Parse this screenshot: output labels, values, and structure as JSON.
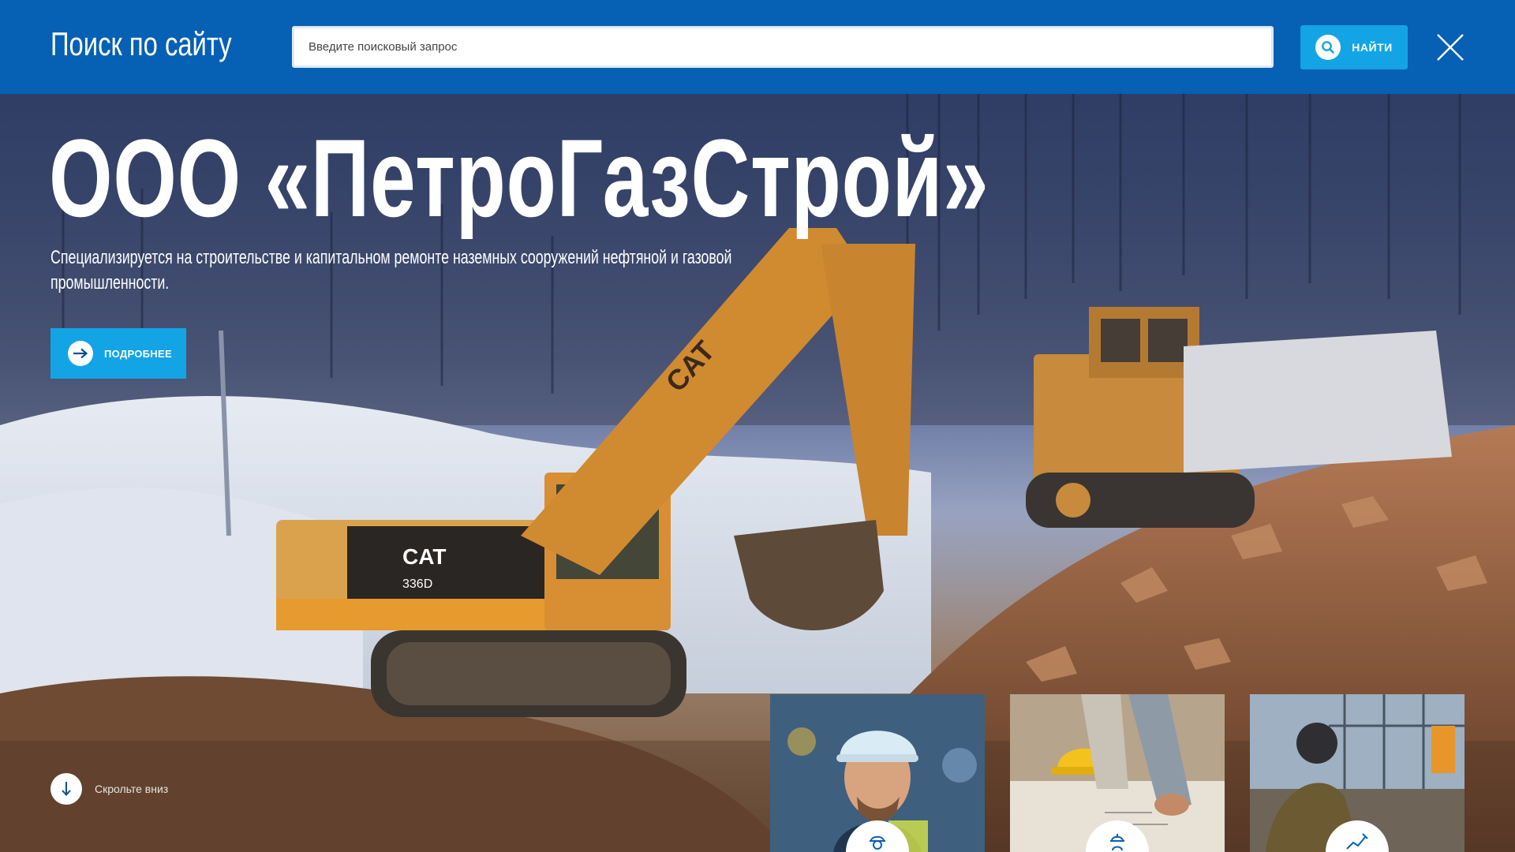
{
  "search": {
    "title": "Поиск по сайту",
    "placeholder": "Введите поисковый запрос",
    "find_label": "НАЙТИ"
  },
  "hero": {
    "company_name": "ООО «ПетроГазСтрой»",
    "description": "Специализируется на строительстве и капитальном ремонте наземных сооружений нефтяной и газовой промышленности.",
    "more_label": "ПОДРОБНЕЕ",
    "scroll_label": "Скрольте вниз"
  },
  "cards": [
    {
      "name": "card-worker-helmet",
      "icon": "worker-icon"
    },
    {
      "name": "card-engineering-plans",
      "icon": "engineer-icon"
    },
    {
      "name": "card-welding",
      "icon": "welding-icon"
    }
  ],
  "colors": {
    "header_bg": "#0660b3",
    "accent": "#13a4e6",
    "text_light": "#ffffff"
  }
}
